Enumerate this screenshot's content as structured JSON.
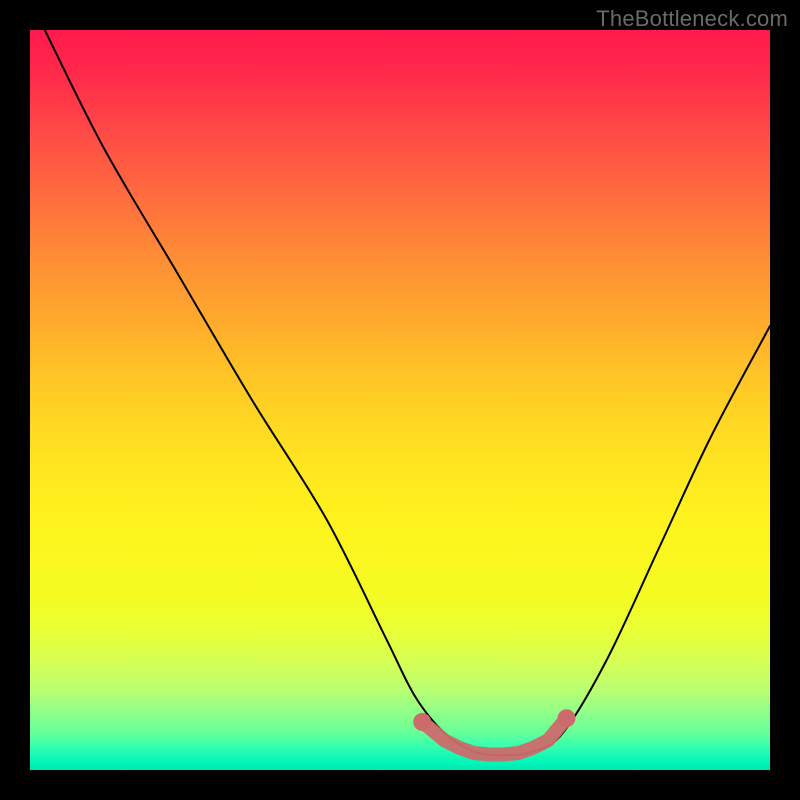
{
  "watermark": "TheBottleneck.com",
  "chart_data": {
    "type": "line",
    "title": "",
    "xlabel": "",
    "ylabel": "",
    "xlim": [
      0,
      100
    ],
    "ylim": [
      0,
      100
    ],
    "grid": false,
    "legend": false,
    "annotations": [],
    "series": [
      {
        "name": "bottleneck-curve",
        "color": "#000000",
        "x": [
          2,
          10,
          20,
          30,
          40,
          48,
          52,
          56,
          60,
          64,
          68,
          72,
          78,
          85,
          92,
          100
        ],
        "y": [
          100,
          84,
          67,
          50,
          34,
          18,
          10,
          5,
          2.5,
          2,
          2.5,
          5,
          15,
          30,
          45,
          60
        ]
      },
      {
        "name": "optimal-range-marker",
        "color": "#cc6b6b",
        "marker": "circle",
        "x": [
          53,
          56,
          58,
          60,
          62,
          64,
          66,
          68,
          70,
          72.5
        ],
        "y": [
          6.5,
          4,
          3,
          2.3,
          2.1,
          2.1,
          2.3,
          3,
          4,
          7
        ]
      }
    ],
    "background_gradient": {
      "direction": "vertical",
      "stops": [
        {
          "pos": 0.0,
          "color": "#ff1a4d"
        },
        {
          "pos": 0.5,
          "color": "#ffd722"
        },
        {
          "pos": 0.8,
          "color": "#eaff35"
        },
        {
          "pos": 1.0,
          "color": "#00e8b4"
        }
      ]
    }
  }
}
